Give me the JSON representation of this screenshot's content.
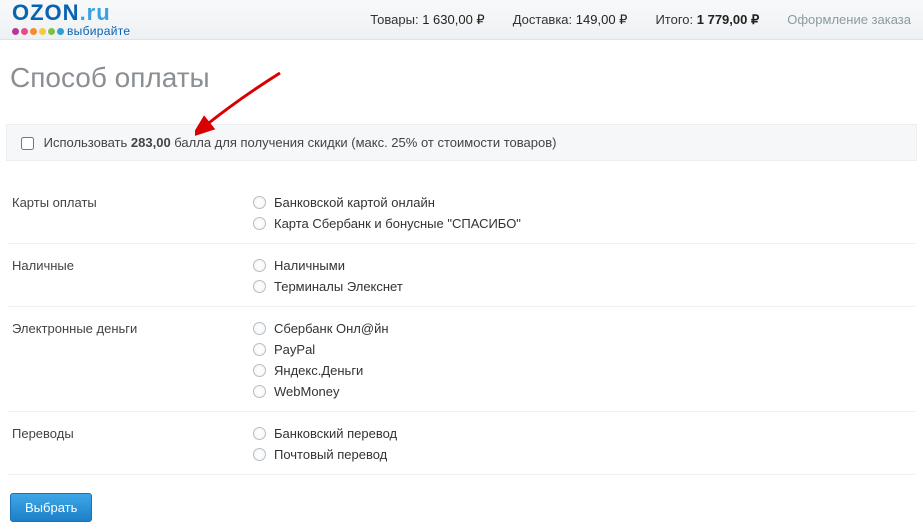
{
  "header": {
    "logo_main": "OZON",
    "logo_suffix": ".ru",
    "logo_tagline": "выбирайте",
    "goods_label": "Товары:",
    "goods_value": "1 630,00 ₽",
    "delivery_label": "Доставка:",
    "delivery_value": "149,00 ₽",
    "total_label": "Итого:",
    "total_value": "1 779,00 ₽",
    "checkout_link": "Оформление заказа"
  },
  "title": "Способ оплаты",
  "points": {
    "prefix": "Использовать ",
    "amount": "283,00",
    "suffix": " балла для получения скидки (макс. 25% от стоимости товаров)"
  },
  "sections": [
    {
      "title": "Карты оплаты",
      "options": [
        "Банковской картой онлайн",
        "Карта Сбербанк и бонусные \"СПАСИБО\""
      ]
    },
    {
      "title": "Наличные",
      "options": [
        "Наличными",
        "Терминалы Элекснет"
      ]
    },
    {
      "title": "Электронные деньги",
      "options": [
        "Сбербанк Онл@йн",
        "PayPal",
        "Яндекс.Деньги",
        "WebMoney"
      ]
    },
    {
      "title": "Переводы",
      "options": [
        "Банковский перевод",
        "Почтовый перевод"
      ]
    }
  ],
  "submit_label": "Выбрать"
}
